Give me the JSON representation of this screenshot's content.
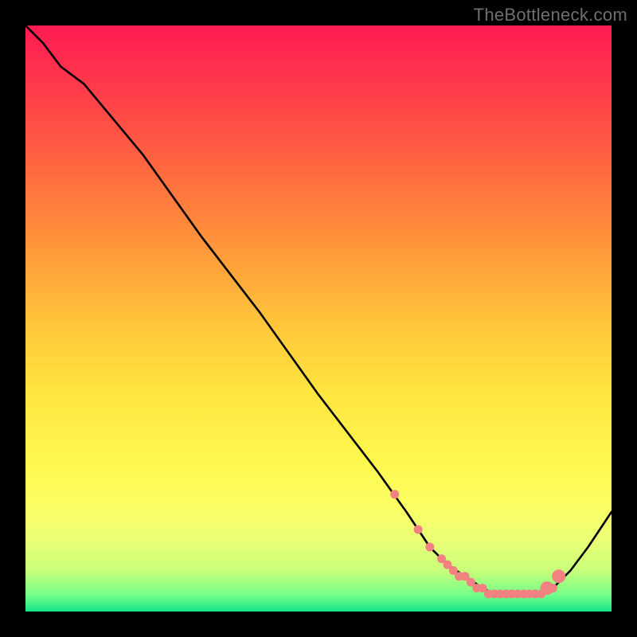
{
  "watermark": "TheBottleneck.com",
  "chart_data": {
    "type": "line",
    "title": "",
    "xlabel": "",
    "ylabel": "",
    "xlim": [
      0,
      100
    ],
    "ylim": [
      0,
      100
    ],
    "series": [
      {
        "name": "curve",
        "x": [
          0,
          3,
          6,
          10,
          20,
          30,
          40,
          50,
          60,
          65,
          69,
          72,
          75,
          78,
          80,
          82,
          85,
          88,
          90,
          93,
          96,
          100
        ],
        "y": [
          100,
          97,
          93,
          90,
          78,
          64,
          51,
          37,
          24,
          17,
          11,
          8,
          6,
          4,
          3,
          3,
          3,
          3,
          4,
          7,
          11,
          17
        ]
      }
    ],
    "markers": {
      "name": "highlight-points",
      "color": "#ff7a7a",
      "x": [
        63,
        67,
        69,
        71,
        72,
        73,
        74,
        75,
        76,
        77,
        78,
        79,
        80,
        81,
        82,
        83,
        84,
        85,
        86,
        87,
        88,
        89,
        90,
        91
      ],
      "y": [
        20,
        14,
        11,
        9,
        8,
        7,
        6,
        6,
        5,
        4,
        4,
        3,
        3,
        3,
        3,
        3,
        3,
        3,
        3,
        3,
        3,
        4,
        4,
        6
      ]
    },
    "big_markers": {
      "name": "big-highlight-points",
      "color": "#ff7a7a",
      "x": [
        89,
        91
      ],
      "y": [
        4,
        6
      ]
    }
  },
  "colors": {
    "curve": "#000000",
    "marker": "#f28181",
    "bg_border": "#000000"
  }
}
